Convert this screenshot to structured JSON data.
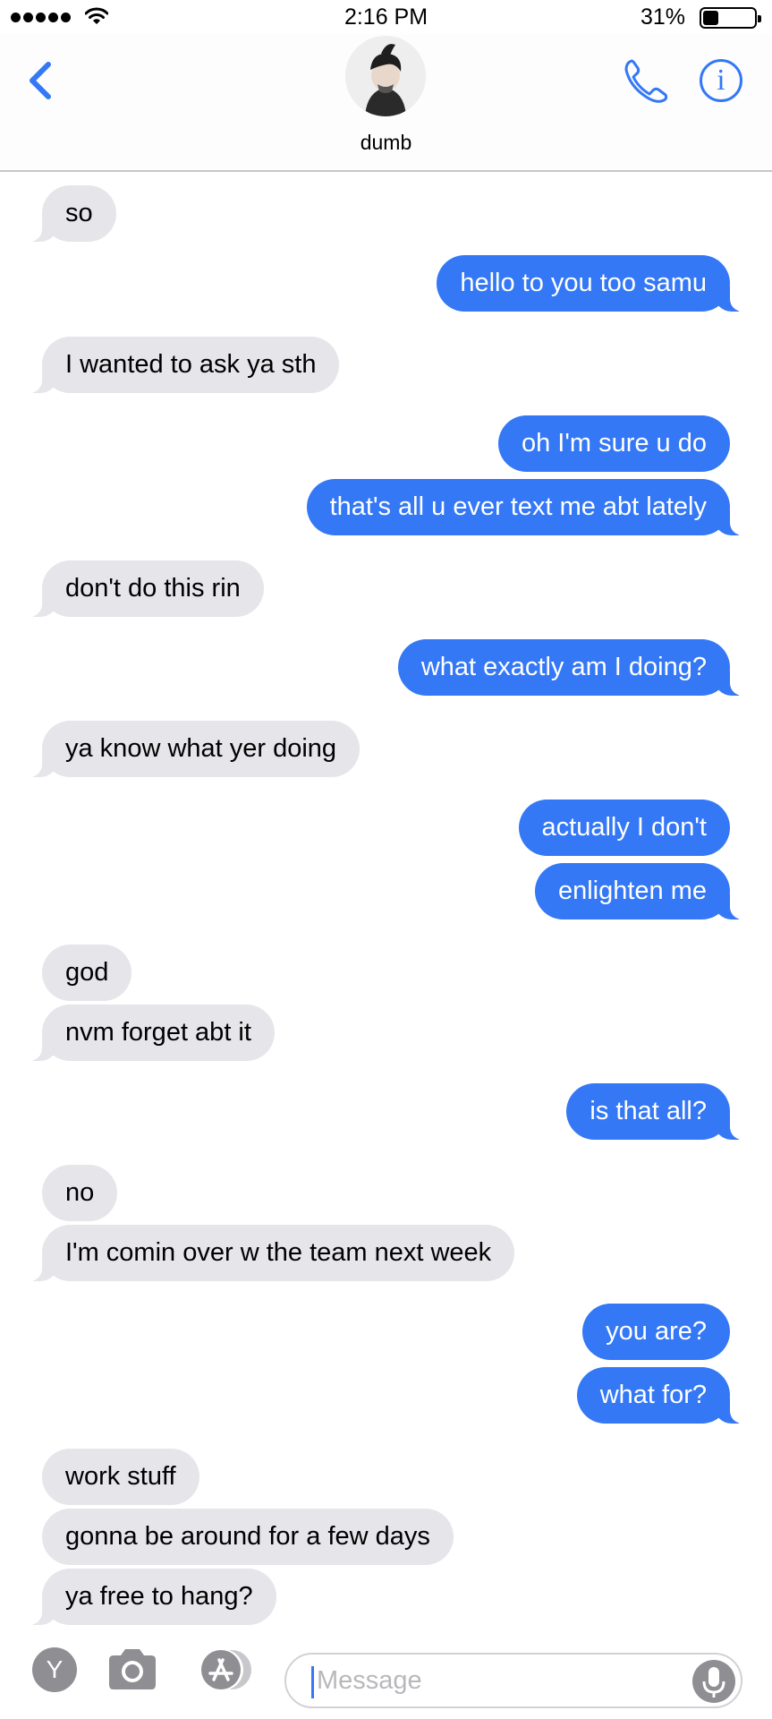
{
  "status_bar": {
    "time": "2:16 PM",
    "battery_percent": "31%",
    "battery_level": 0.31,
    "signal_bars": 5
  },
  "header": {
    "contact_name": "dumb",
    "back_icon": "chevron-left-icon",
    "call_icon": "phone-icon",
    "info_icon": "info-icon",
    "info_glyph": "i"
  },
  "colors": {
    "outgoing_bubble": "#3478f6",
    "incoming_bubble": "#e5e5ea",
    "accent": "#3478f6"
  },
  "messages": [
    {
      "direction": "in",
      "text": "so"
    },
    {
      "direction": "out",
      "text": "hello to you too samu"
    },
    {
      "direction": "in",
      "text": "I wanted to ask ya sth"
    },
    {
      "direction": "out",
      "text": "oh I'm sure u do"
    },
    {
      "direction": "out",
      "text": "that's all u ever text me abt lately"
    },
    {
      "direction": "in",
      "text": "don't do this rin"
    },
    {
      "direction": "out",
      "text": "what exactly am I doing?"
    },
    {
      "direction": "in",
      "text": "ya know what yer doing"
    },
    {
      "direction": "out",
      "text": "actually I don't"
    },
    {
      "direction": "out",
      "text": "enlighten me"
    },
    {
      "direction": "in",
      "text": "god"
    },
    {
      "direction": "in",
      "text": "nvm forget abt it"
    },
    {
      "direction": "out",
      "text": "is that all?"
    },
    {
      "direction": "in",
      "text": "no"
    },
    {
      "direction": "in",
      "text": "I'm comin over w the team next week"
    },
    {
      "direction": "out",
      "text": "you are?"
    },
    {
      "direction": "out",
      "text": "what for?"
    },
    {
      "direction": "in",
      "text": "work stuff"
    },
    {
      "direction": "in",
      "text": "gonna be around for a few days"
    },
    {
      "direction": "in",
      "text": "ya free to hang?"
    }
  ],
  "input_bar": {
    "app_button_letter": "Y",
    "camera_icon": "camera-icon",
    "apps_icon": "app-store-icon",
    "placeholder": "Message",
    "mic_icon": "microphone-icon"
  }
}
